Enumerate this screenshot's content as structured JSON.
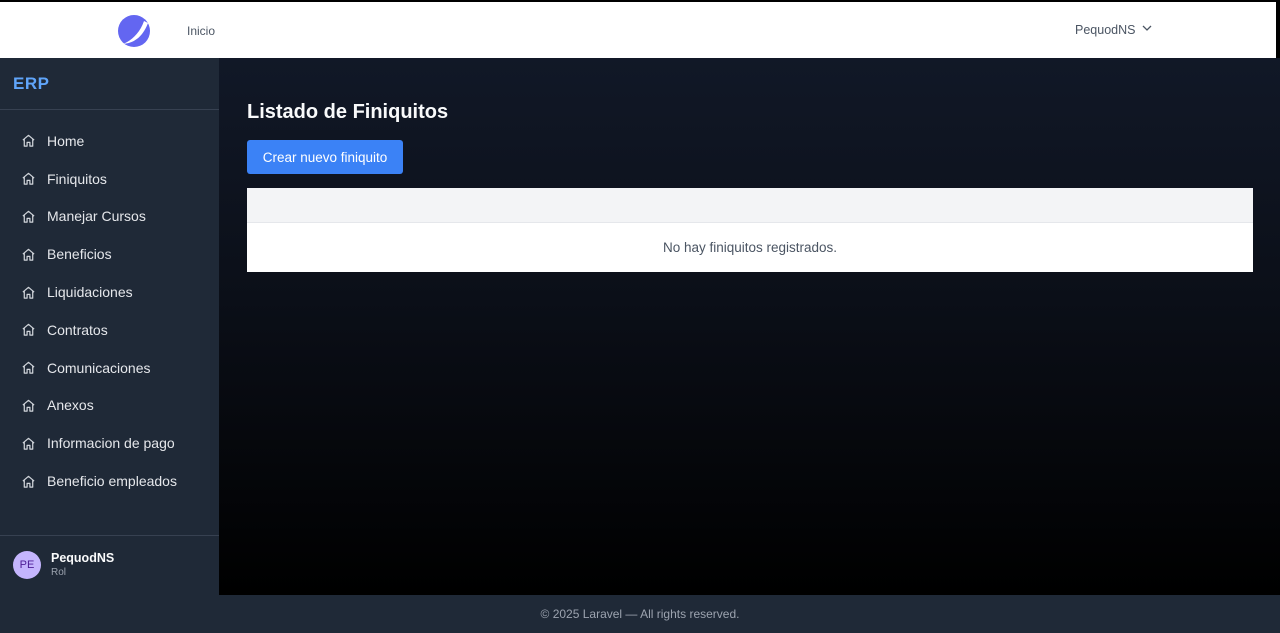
{
  "topbar": {
    "logo_icon": "moon-crescent-logo-icon",
    "nav": [
      {
        "label": "Inicio"
      }
    ],
    "user": {
      "name": "PequodNS",
      "dropdown_icon": "chevron-down-icon"
    }
  },
  "sidebar": {
    "brand": "ERP",
    "items": [
      {
        "label": "Home",
        "icon": "home-icon"
      },
      {
        "label": "Finiquitos",
        "icon": "home-icon"
      },
      {
        "label": "Manejar Cursos",
        "icon": "home-icon"
      },
      {
        "label": "Beneficios",
        "icon": "home-icon"
      },
      {
        "label": "Liquidaciones",
        "icon": "home-icon"
      },
      {
        "label": "Contratos",
        "icon": "home-icon"
      },
      {
        "label": "Comunicaciones",
        "icon": "home-icon"
      },
      {
        "label": "Anexos",
        "icon": "home-icon"
      },
      {
        "label": "Informacion de pago",
        "icon": "home-icon"
      },
      {
        "label": "Beneficio empleados",
        "icon": "home-icon"
      }
    ],
    "profile": {
      "initials": "PE",
      "name": "PequodNS",
      "role": "Rol"
    }
  },
  "main": {
    "title": "Listado de Finiquitos",
    "create_button": "Crear nuevo finiquito",
    "empty_message": "No hay finiquitos registrados."
  },
  "footer": {
    "text": "© 2025 Laravel — All rights reserved."
  },
  "colors": {
    "accent": "#3b82f6",
    "brand": "#60a5fa",
    "sidebar_bg": "#1f2937",
    "avatar_bg": "#c4b5fd",
    "logo": "#6366f1"
  }
}
